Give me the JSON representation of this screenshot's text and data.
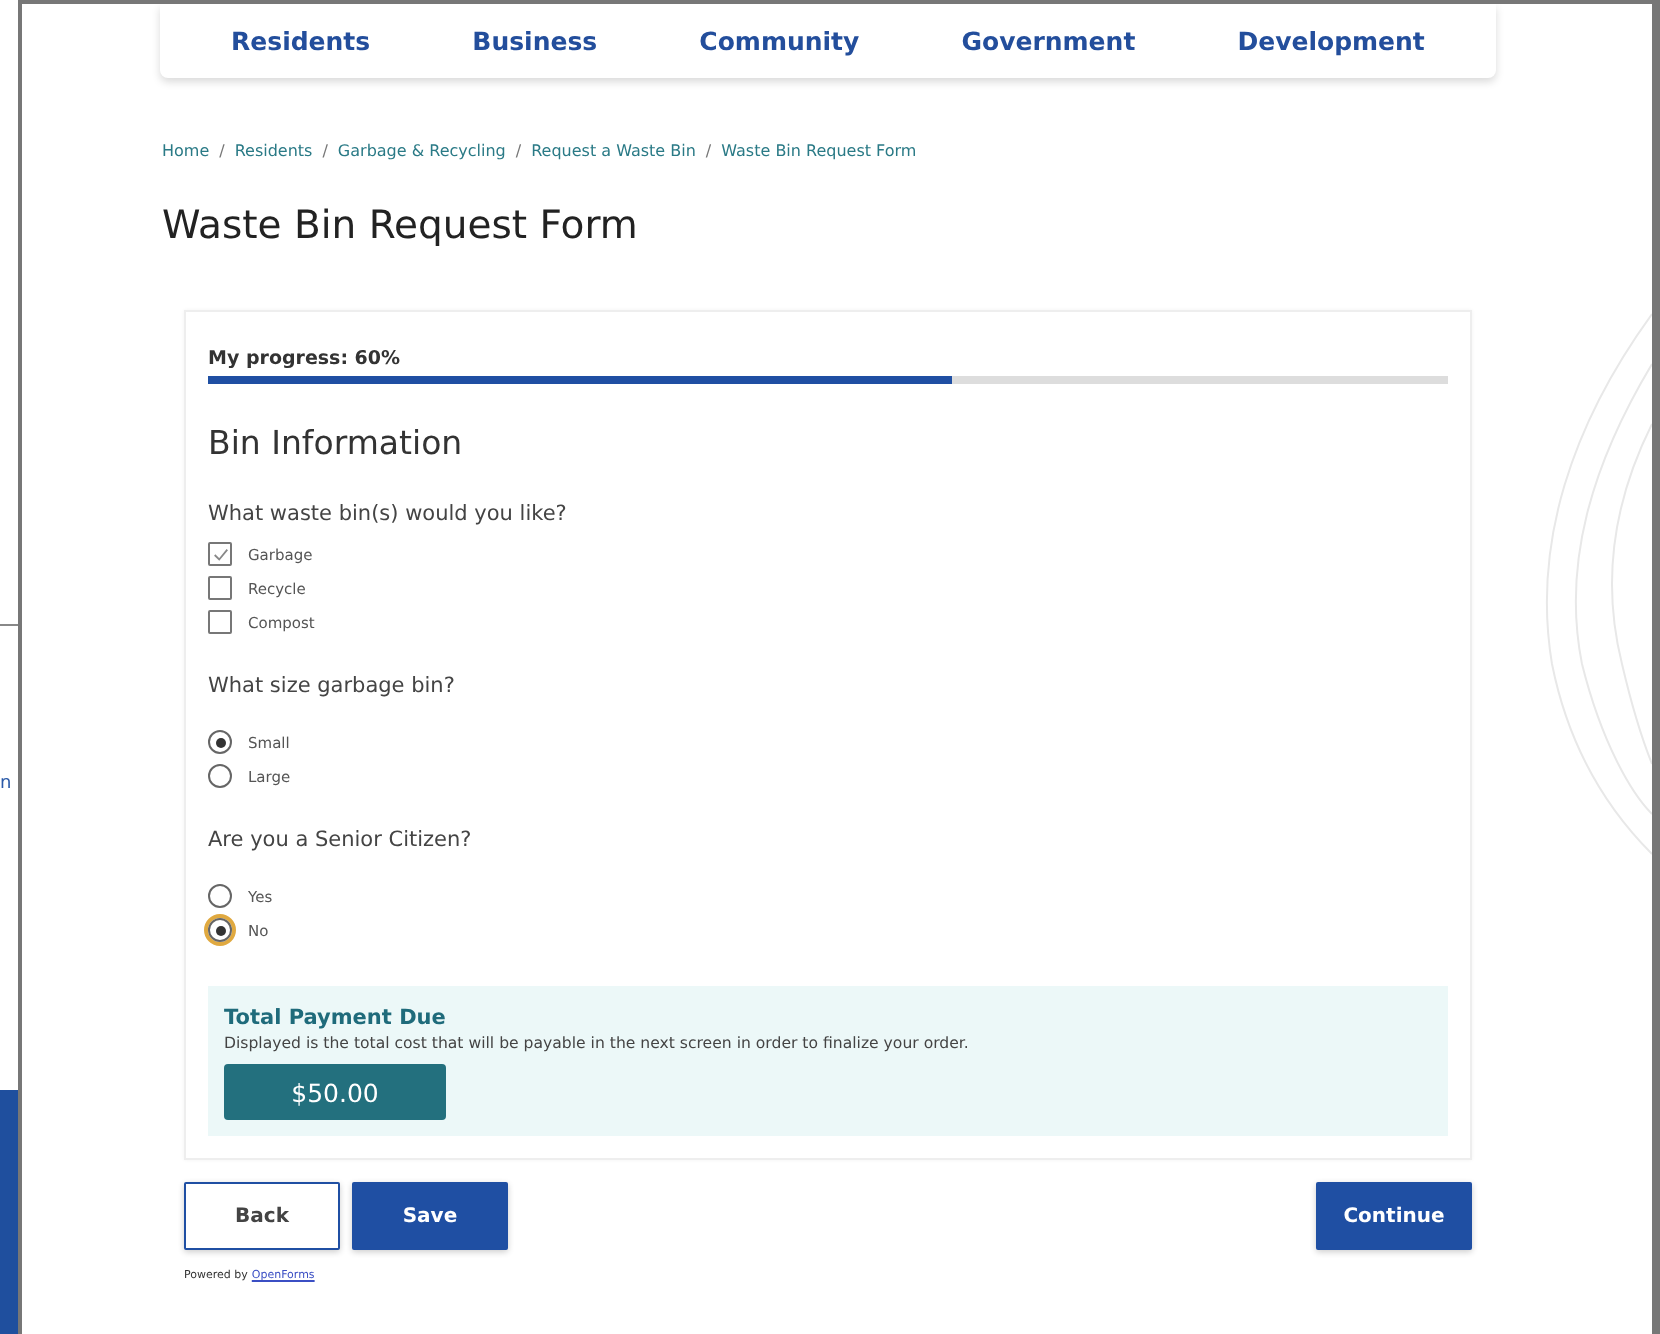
{
  "background_window": {
    "text": "n"
  },
  "nav": [
    {
      "label": "Residents"
    },
    {
      "label": "Business"
    },
    {
      "label": "Community"
    },
    {
      "label": "Government"
    },
    {
      "label": "Development"
    }
  ],
  "breadcrumbs": [
    {
      "label": "Home"
    },
    {
      "separator": "/",
      "label": "Residents"
    },
    {
      "separator": "/",
      "label": "Garbage & Recycling"
    },
    {
      "separator": "/",
      "label": "Request a Waste Bin"
    },
    {
      "separator": "/",
      "label": "Waste Bin Request Form"
    }
  ],
  "title": "Waste Bin Request Form",
  "progress": {
    "label": "My progress: 60%",
    "level": 0.6
  },
  "section_title": "Bin Information",
  "questions": [
    {
      "kind": "checkbox",
      "label": "What waste bin(s) would you like?",
      "options": [
        {
          "label": "Garbage",
          "checked": true
        },
        {
          "label": "Recycle",
          "checked": false
        },
        {
          "label": "Compost",
          "checked": false
        }
      ]
    },
    {
      "kind": "radio",
      "label": "What size garbage bin?",
      "options": [
        {
          "label": "Small",
          "selected": true,
          "focused": false
        },
        {
          "label": "Large",
          "selected": false,
          "focused": false
        }
      ]
    },
    {
      "kind": "radio",
      "label": "Are you a Senior Citizen?",
      "options": [
        {
          "label": "Yes",
          "selected": false,
          "focused": false
        },
        {
          "label": "No",
          "selected": true,
          "focused": true
        }
      ]
    }
  ],
  "payment": {
    "title": "Total Payment Due",
    "description": "Displayed is the total cost that will be payable in the next screen in order to finalize your order.",
    "amount": "$50.00"
  },
  "buttons": [
    {
      "label": "Back",
      "kind": "secondary"
    },
    {
      "label": "Save",
      "kind": "primary"
    },
    {
      "label": "Continue",
      "kind": "primary"
    }
  ],
  "footer": {
    "prefix": "Powered by",
    "link": "OpenForms"
  }
}
